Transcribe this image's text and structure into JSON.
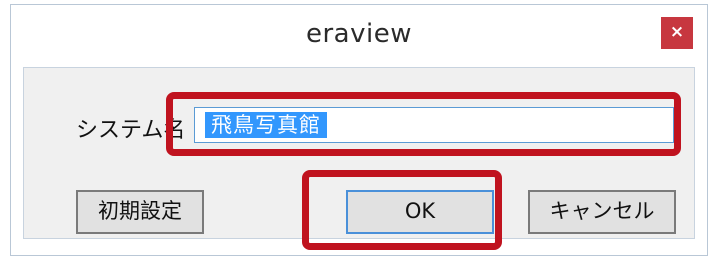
{
  "window": {
    "title": "eraview",
    "close_label": "×"
  },
  "form": {
    "system_name_label": "システム名",
    "system_name_value": "飛鳥写真館"
  },
  "buttons": {
    "init_label": "初期設定",
    "ok_label": "OK",
    "cancel_label": "キャンセル"
  },
  "colors": {
    "highlight": "#c0131f",
    "close_button": "#c7373f",
    "selection": "#3297fd"
  }
}
